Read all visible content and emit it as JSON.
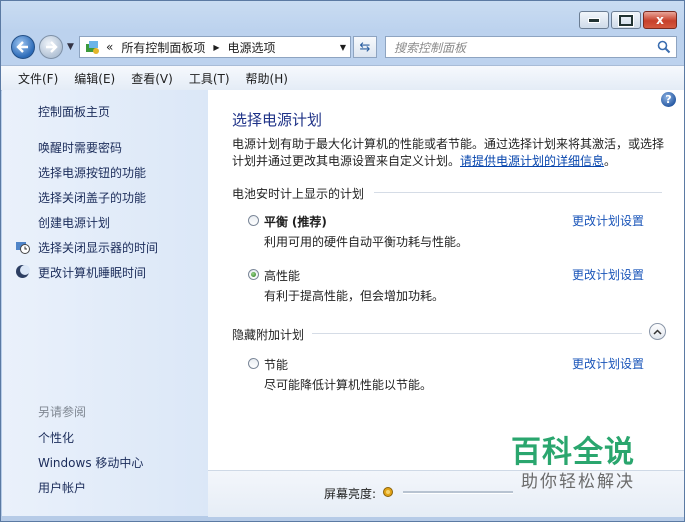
{
  "window": {
    "caption_buttons": {
      "minimize_icon": "minimize-icon",
      "maximize_icon": "maximize-icon",
      "close_icon": "close-icon",
      "close_glyph": "x"
    }
  },
  "nav": {
    "back_icon": "arrow-left-icon",
    "forward_icon": "arrow-right-icon",
    "address": {
      "prefix": "«",
      "crumbs": [
        "所有控制面板项",
        "电源选项"
      ],
      "separator": "▶"
    },
    "search_placeholder": "搜索控制面板"
  },
  "menubar": {
    "items": [
      "文件(F)",
      "编辑(E)",
      "查看(V)",
      "工具(T)",
      "帮助(H)"
    ]
  },
  "sidebar": {
    "home": "控制面板主页",
    "links": [
      "唤醒时需要密码",
      "选择电源按钮的功能",
      "选择关闭盖子的功能",
      "创建电源计划",
      "选择关闭显示器的时间",
      "更改计算机睡眠时间"
    ],
    "see_also_title": "另请参阅",
    "see_also": [
      "个性化",
      "Windows 移动中心",
      "用户帐户"
    ]
  },
  "main": {
    "title": "选择电源计划",
    "intro_text": "电源计划有助于最大化计算机的性能或者节能。通过选择计划来将其激活，或选择计划并通过更改其电源设置来自定义计划。",
    "intro_link": "请提供电源计划的详细信息",
    "intro_tail": "。",
    "battery_group": "电池安时计上显示的计划",
    "hidden_group": "隐藏附加计划",
    "change_link": "更改计划设置",
    "plans": [
      {
        "name": "平衡",
        "tag": "(推荐)",
        "desc": "利用可用的硬件自动平衡功耗与性能。",
        "selected": false
      },
      {
        "name": "高性能",
        "tag": "",
        "desc": "有利于提高性能，但会增加功耗。",
        "selected": true
      },
      {
        "name": "节能",
        "tag": "",
        "desc": "尽可能降低计算机性能以节能。",
        "selected": false
      }
    ],
    "brightness_label": "屏幕亮度:"
  },
  "watermark": {
    "line1": "百科全说",
    "line2": "助你轻松解决"
  },
  "colors": {
    "link": "#1a55b9",
    "title": "#1e3287",
    "accent_green": "#2aa66e"
  }
}
